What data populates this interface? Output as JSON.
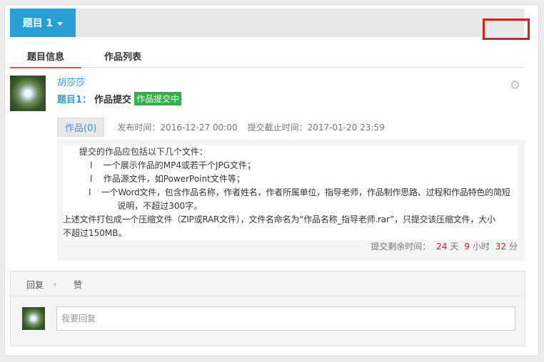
{
  "topic": {
    "button_label": "题目 1"
  },
  "tabs": [
    "题目信息",
    "作品列表"
  ],
  "post": {
    "author": "胡莎莎",
    "title_prefix": "题目1：",
    "title_text": "作品提交",
    "status": "作品提交中",
    "works_button": "作品(0)",
    "publish_time": "发布时间：2016-12-27 00:00",
    "deadline": "提交截止时间：2017-01-20 23:59"
  },
  "description": {
    "lines": [
      "      提交的作品应包括以下几个文件：",
      "          l    一个展示作品的MP4或若干个JPG文件；",
      "          l    作品源文件，如PowerPoint文件等；",
      "          l    一个Word文件，包含作品名称，作者姓名，作者所属单位，指导老师，作品制作思路、过程和作品特色的简短",
      "                    说明，不超过300字。",
      "上述文件打包成一个压缩文件（ZIP或RAR文件），文件名命名为“作品名称_指导老师.rar”，只提交该压缩文件，大小",
      "不超过150MB。"
    ]
  },
  "remaining": {
    "prefix": "提交剩余时间：",
    "days": "24",
    "days_unit": "天",
    "hours": "9",
    "hours_unit": "小时",
    "minutes": "32",
    "minutes_unit": "分"
  },
  "reply": {
    "tab_reply": "回复",
    "tab_like": "赞",
    "placeholder": "我要回复"
  }
}
